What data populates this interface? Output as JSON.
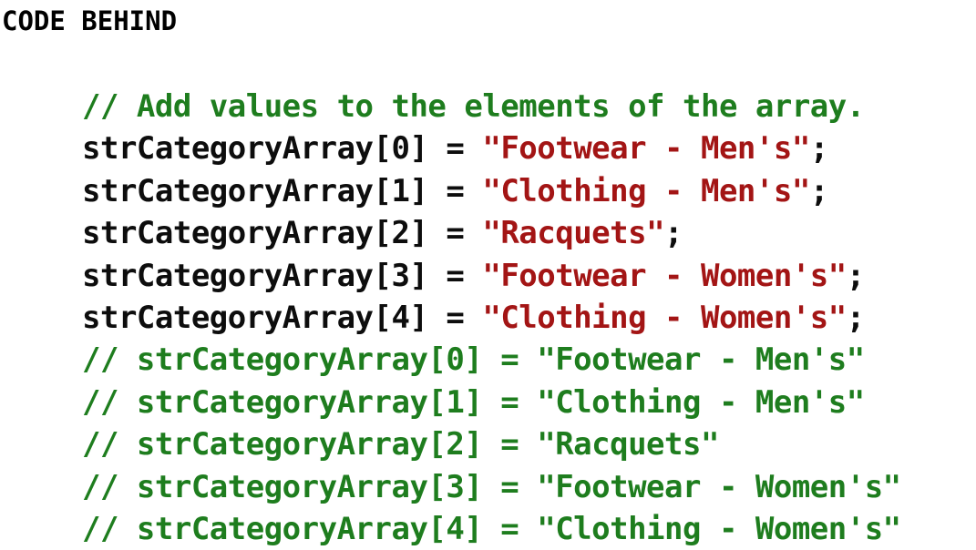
{
  "heading": "CODE BEHIND",
  "code": {
    "comment_header": "// Add values to the elements of the array.",
    "assignments": [
      {
        "lhs": "strCategoryArray[0] = ",
        "value": "\"Footwear - Men's\"",
        "end": ";"
      },
      {
        "lhs": "strCategoryArray[1] = ",
        "value": "\"Clothing - Men's\"",
        "end": ";"
      },
      {
        "lhs": "strCategoryArray[2] = ",
        "value": "\"Racquets\"",
        "end": ";"
      },
      {
        "lhs": "strCategoryArray[3] = ",
        "value": "\"Footwear - Women's\"",
        "end": ";"
      },
      {
        "lhs": "strCategoryArray[4] = ",
        "value": "\"Clothing - Women's\"",
        "end": ";"
      }
    ],
    "comment_lines": [
      "// strCategoryArray[0] = \"Footwear - Men's\"",
      "// strCategoryArray[1] = \"Clothing - Men's\"",
      "// strCategoryArray[2] = \"Racquets\"",
      "// strCategoryArray[3] = \"Footwear - Women's\"",
      "// strCategoryArray[4] = \"Clothing - Women's\""
    ]
  },
  "colors": {
    "comment": "#1e7d1e",
    "code": "#0d0d0d",
    "string": "#a31515"
  }
}
